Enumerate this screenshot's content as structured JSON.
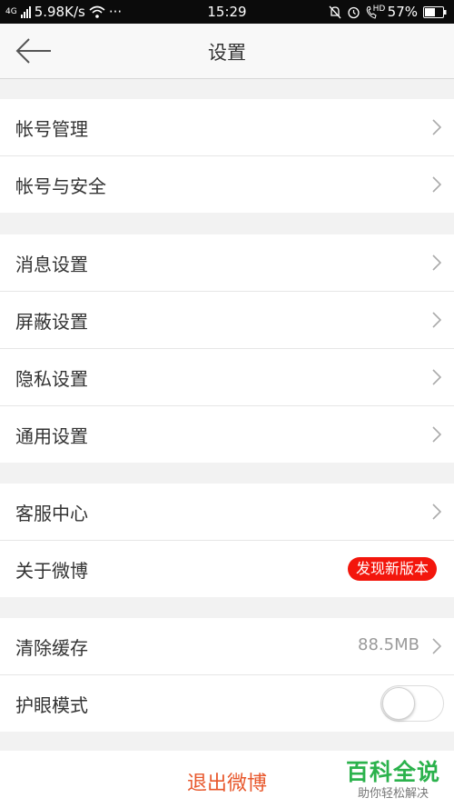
{
  "status_bar": {
    "network_type": "4G",
    "speed": "5.98K/s",
    "more": "···",
    "time": "15:29",
    "battery": "57%",
    "call_icon_label": "HD"
  },
  "header": {
    "title": "设置"
  },
  "groups": [
    {
      "items": [
        {
          "label": "帐号管理"
        },
        {
          "label": "帐号与安全"
        }
      ]
    },
    {
      "items": [
        {
          "label": "消息设置"
        },
        {
          "label": "屏蔽设置"
        },
        {
          "label": "隐私设置"
        },
        {
          "label": "通用设置"
        }
      ]
    },
    {
      "items": [
        {
          "label": "客服中心"
        },
        {
          "label": "关于微博",
          "badge": "发现新版本"
        }
      ]
    },
    {
      "items": [
        {
          "label": "清除缓存",
          "value": "88.5MB"
        },
        {
          "label": "护眼模式",
          "toggle": false
        }
      ]
    }
  ],
  "logout_label": "退出微博",
  "watermark": {
    "main": "百科全说",
    "sub": "助你轻松解决"
  },
  "colors": {
    "badge": "#f3160c",
    "logout": "#e8582c",
    "watermark": "#2bb24c"
  }
}
